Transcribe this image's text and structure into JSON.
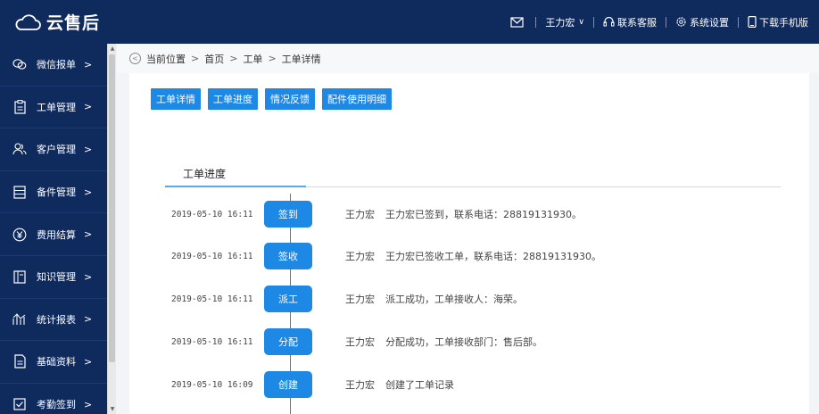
{
  "app": {
    "title": "云售后"
  },
  "topbar": {
    "user": "王力宏",
    "support": "联系客服",
    "settings": "系统设置",
    "mobile": "下载手机版"
  },
  "sidebar": {
    "items": [
      {
        "label": "微信报单",
        "icon": "wechat-icon"
      },
      {
        "label": "工单管理",
        "icon": "clipboard-icon"
      },
      {
        "label": "客户管理",
        "icon": "users-icon"
      },
      {
        "label": "备件管理",
        "icon": "list-icon"
      },
      {
        "label": "费用结算",
        "icon": "yuan-icon"
      },
      {
        "label": "知识管理",
        "icon": "book-icon"
      },
      {
        "label": "统计报表",
        "icon": "chart-icon"
      },
      {
        "label": "基础资料",
        "icon": "document-icon"
      },
      {
        "label": "考勤签到",
        "icon": "checkbox-icon"
      }
    ]
  },
  "breadcrumb": {
    "prefix": "当前位置",
    "items": [
      "首页",
      "工单",
      "工单详情"
    ]
  },
  "buttons": [
    "工单详情",
    "工单进度",
    "情况反馈",
    "配件使用明细"
  ],
  "tab": {
    "active": "工单进度"
  },
  "timeline": [
    {
      "time": "2019-05-10 16:11",
      "status": "签到",
      "user": "王力宏",
      "desc": "王力宏已签到，联系电话：28819131930。"
    },
    {
      "time": "2019-05-10 16:11",
      "status": "签收",
      "user": "王力宏",
      "desc": "王力宏已签收工单，联系电话：28819131930。"
    },
    {
      "time": "2019-05-10 16:11",
      "status": "派工",
      "user": "王力宏",
      "desc": "派工成功，工单接收人：海荣。"
    },
    {
      "time": "2019-05-10 16:11",
      "status": "分配",
      "user": "王力宏",
      "desc": "分配成功，工单接收部门：售后部。"
    },
    {
      "time": "2019-05-10 16:09",
      "status": "创建",
      "user": "王力宏",
      "desc": "创建了工单记录"
    }
  ],
  "colors": {
    "nav_bg": "#0f2a5c",
    "accent": "#1e88e5"
  }
}
